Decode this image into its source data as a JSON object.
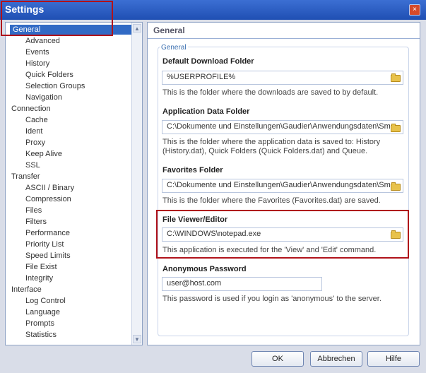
{
  "window": {
    "title": "Settings",
    "close_label": "×"
  },
  "tree": {
    "items": [
      {
        "label": "General",
        "level": 0,
        "selected": true
      },
      {
        "label": "Advanced",
        "level": 1
      },
      {
        "label": "Events",
        "level": 1
      },
      {
        "label": "History",
        "level": 1
      },
      {
        "label": "Quick Folders",
        "level": 1
      },
      {
        "label": "Selection Groups",
        "level": 1
      },
      {
        "label": "Navigation",
        "level": 1
      },
      {
        "label": "Connection",
        "level": 0
      },
      {
        "label": "Cache",
        "level": 1
      },
      {
        "label": "Ident",
        "level": 1
      },
      {
        "label": "Proxy",
        "level": 1
      },
      {
        "label": "Keep Alive",
        "level": 1
      },
      {
        "label": "SSL",
        "level": 1
      },
      {
        "label": "Transfer",
        "level": 0
      },
      {
        "label": "ASCII / Binary",
        "level": 1
      },
      {
        "label": "Compression",
        "level": 1
      },
      {
        "label": "Files",
        "level": 1
      },
      {
        "label": "Filters",
        "level": 1
      },
      {
        "label": "Performance",
        "level": 1
      },
      {
        "label": "Priority List",
        "level": 1
      },
      {
        "label": "Speed Limits",
        "level": 1
      },
      {
        "label": "File Exist",
        "level": 1
      },
      {
        "label": "Integrity",
        "level": 1
      },
      {
        "label": "Interface",
        "level": 0
      },
      {
        "label": "Log Control",
        "level": 1
      },
      {
        "label": "Language",
        "level": 1
      },
      {
        "label": "Prompts",
        "level": 1
      },
      {
        "label": "Statistics",
        "level": 1
      }
    ]
  },
  "main": {
    "header": "General",
    "group_label": "General",
    "download_folder": {
      "label": "Default Download Folder",
      "value": "%USERPROFILE%",
      "help": "This is the folder where the downloads are saved to by default."
    },
    "app_data_folder": {
      "label": "Application Data Folder",
      "value": "C:\\Dokumente und Einstellungen\\Gaudier\\Anwendungsdaten\\Sm",
      "help_line1": "This is the folder where the application data is saved to: History",
      "help_line2": "(History.dat), Quick Folders (Quick Folders.dat) and Queue."
    },
    "favorites_folder": {
      "label": "Favorites Folder",
      "value": "C:\\Dokumente und Einstellungen\\Gaudier\\Anwendungsdaten\\Sm",
      "help": "This is the folder where the Favorites (Favorites.dat) are saved."
    },
    "viewer": {
      "label": "File Viewer/Editor",
      "value": "C:\\WINDOWS\\notepad.exe",
      "help": "This application is executed for the 'View' and 'Edit' command."
    },
    "anonymous": {
      "label": "Anonymous Password",
      "value": "user@host.com",
      "help": "This password is used if you login as 'anonymous' to the server."
    }
  },
  "buttons": {
    "ok": "OK",
    "cancel": "Abbrechen",
    "help": "Hilfe"
  }
}
